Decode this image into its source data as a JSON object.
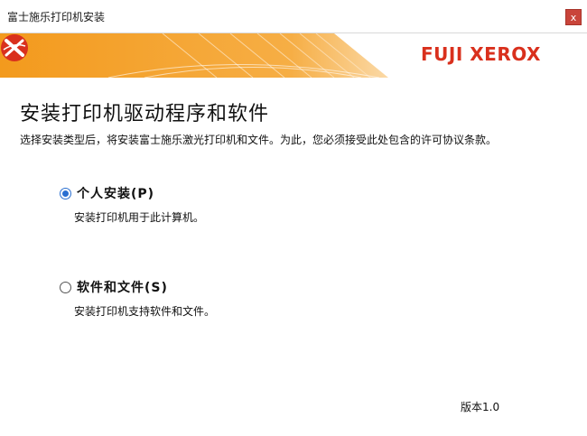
{
  "window": {
    "title": "富士施乐打印机安装",
    "close_label": "x"
  },
  "banner": {
    "brand": "FUJI XEROX",
    "colors": {
      "orange": "#f39a1d",
      "brand_red": "#d9301d"
    }
  },
  "main": {
    "heading": "安装打印机驱动程序和软件",
    "description": "选择安装类型后，将安装富士施乐激光打印机和文件。为此，您必须接受此处包含的许可协议条款。"
  },
  "options": [
    {
      "label": "个人安装(P)",
      "description": "安装打印机用于此计算机。",
      "selected": true
    },
    {
      "label": "软件和文件(S)",
      "description": "安装打印机支持软件和文件。",
      "selected": false
    }
  ],
  "footer": {
    "version": "版本1.0"
  }
}
